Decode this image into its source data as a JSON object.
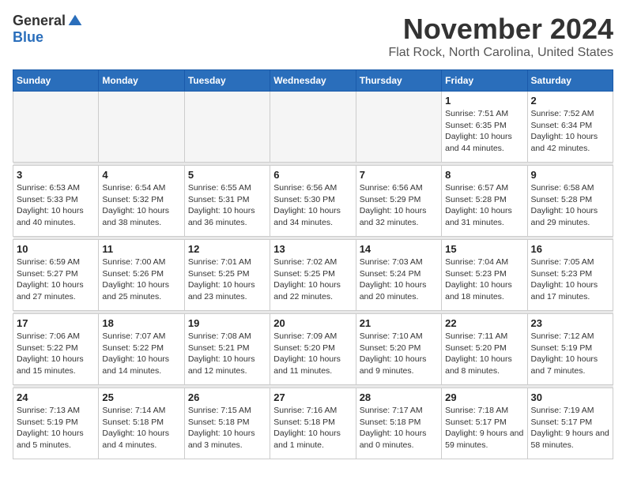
{
  "logo": {
    "general": "General",
    "blue": "Blue"
  },
  "header": {
    "month": "November 2024",
    "location": "Flat Rock, North Carolina, United States"
  },
  "weekdays": [
    "Sunday",
    "Monday",
    "Tuesday",
    "Wednesday",
    "Thursday",
    "Friday",
    "Saturday"
  ],
  "weeks": [
    [
      {
        "day": "",
        "info": ""
      },
      {
        "day": "",
        "info": ""
      },
      {
        "day": "",
        "info": ""
      },
      {
        "day": "",
        "info": ""
      },
      {
        "day": "",
        "info": ""
      },
      {
        "day": "1",
        "info": "Sunrise: 7:51 AM\nSunset: 6:35 PM\nDaylight: 10 hours and 44 minutes."
      },
      {
        "day": "2",
        "info": "Sunrise: 7:52 AM\nSunset: 6:34 PM\nDaylight: 10 hours and 42 minutes."
      }
    ],
    [
      {
        "day": "3",
        "info": "Sunrise: 6:53 AM\nSunset: 5:33 PM\nDaylight: 10 hours and 40 minutes."
      },
      {
        "day": "4",
        "info": "Sunrise: 6:54 AM\nSunset: 5:32 PM\nDaylight: 10 hours and 38 minutes."
      },
      {
        "day": "5",
        "info": "Sunrise: 6:55 AM\nSunset: 5:31 PM\nDaylight: 10 hours and 36 minutes."
      },
      {
        "day": "6",
        "info": "Sunrise: 6:56 AM\nSunset: 5:30 PM\nDaylight: 10 hours and 34 minutes."
      },
      {
        "day": "7",
        "info": "Sunrise: 6:56 AM\nSunset: 5:29 PM\nDaylight: 10 hours and 32 minutes."
      },
      {
        "day": "8",
        "info": "Sunrise: 6:57 AM\nSunset: 5:28 PM\nDaylight: 10 hours and 31 minutes."
      },
      {
        "day": "9",
        "info": "Sunrise: 6:58 AM\nSunset: 5:28 PM\nDaylight: 10 hours and 29 minutes."
      }
    ],
    [
      {
        "day": "10",
        "info": "Sunrise: 6:59 AM\nSunset: 5:27 PM\nDaylight: 10 hours and 27 minutes."
      },
      {
        "day": "11",
        "info": "Sunrise: 7:00 AM\nSunset: 5:26 PM\nDaylight: 10 hours and 25 minutes."
      },
      {
        "day": "12",
        "info": "Sunrise: 7:01 AM\nSunset: 5:25 PM\nDaylight: 10 hours and 23 minutes."
      },
      {
        "day": "13",
        "info": "Sunrise: 7:02 AM\nSunset: 5:25 PM\nDaylight: 10 hours and 22 minutes."
      },
      {
        "day": "14",
        "info": "Sunrise: 7:03 AM\nSunset: 5:24 PM\nDaylight: 10 hours and 20 minutes."
      },
      {
        "day": "15",
        "info": "Sunrise: 7:04 AM\nSunset: 5:23 PM\nDaylight: 10 hours and 18 minutes."
      },
      {
        "day": "16",
        "info": "Sunrise: 7:05 AM\nSunset: 5:23 PM\nDaylight: 10 hours and 17 minutes."
      }
    ],
    [
      {
        "day": "17",
        "info": "Sunrise: 7:06 AM\nSunset: 5:22 PM\nDaylight: 10 hours and 15 minutes."
      },
      {
        "day": "18",
        "info": "Sunrise: 7:07 AM\nSunset: 5:22 PM\nDaylight: 10 hours and 14 minutes."
      },
      {
        "day": "19",
        "info": "Sunrise: 7:08 AM\nSunset: 5:21 PM\nDaylight: 10 hours and 12 minutes."
      },
      {
        "day": "20",
        "info": "Sunrise: 7:09 AM\nSunset: 5:20 PM\nDaylight: 10 hours and 11 minutes."
      },
      {
        "day": "21",
        "info": "Sunrise: 7:10 AM\nSunset: 5:20 PM\nDaylight: 10 hours and 9 minutes."
      },
      {
        "day": "22",
        "info": "Sunrise: 7:11 AM\nSunset: 5:20 PM\nDaylight: 10 hours and 8 minutes."
      },
      {
        "day": "23",
        "info": "Sunrise: 7:12 AM\nSunset: 5:19 PM\nDaylight: 10 hours and 7 minutes."
      }
    ],
    [
      {
        "day": "24",
        "info": "Sunrise: 7:13 AM\nSunset: 5:19 PM\nDaylight: 10 hours and 5 minutes."
      },
      {
        "day": "25",
        "info": "Sunrise: 7:14 AM\nSunset: 5:18 PM\nDaylight: 10 hours and 4 minutes."
      },
      {
        "day": "26",
        "info": "Sunrise: 7:15 AM\nSunset: 5:18 PM\nDaylight: 10 hours and 3 minutes."
      },
      {
        "day": "27",
        "info": "Sunrise: 7:16 AM\nSunset: 5:18 PM\nDaylight: 10 hours and 1 minute."
      },
      {
        "day": "28",
        "info": "Sunrise: 7:17 AM\nSunset: 5:18 PM\nDaylight: 10 hours and 0 minutes."
      },
      {
        "day": "29",
        "info": "Sunrise: 7:18 AM\nSunset: 5:17 PM\nDaylight: 9 hours and 59 minutes."
      },
      {
        "day": "30",
        "info": "Sunrise: 7:19 AM\nSunset: 5:17 PM\nDaylight: 9 hours and 58 minutes."
      }
    ]
  ]
}
